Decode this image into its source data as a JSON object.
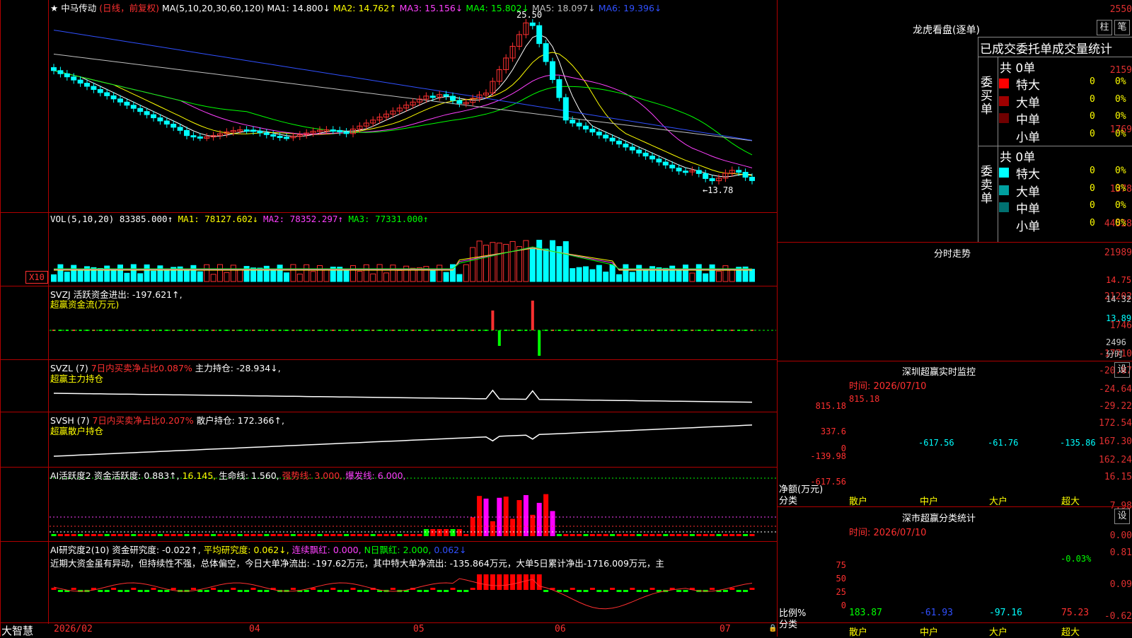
{
  "main": {
    "stock_name": "中马传动",
    "period": "(日线，前复权)",
    "ma_label": "MA(5,10,20,30,60,120)",
    "ma_values": [
      {
        "text": "MA1: 14.800↓",
        "color": "#ffffff"
      },
      {
        "text": "MA2: 14.762↑",
        "color": "#ffff00"
      },
      {
        "text": "MA3: 15.156↓",
        "color": "#ff40ff"
      },
      {
        "text": "MA4: 15.802↓",
        "color": "#00ff00"
      },
      {
        "text": "MA5: 18.097↓",
        "color": "#c0c0c0"
      },
      {
        "text": "MA6: 19.396↓",
        "color": "#3050ff"
      }
    ],
    "y_ticks": [
      "2550",
      "2159",
      "1769",
      "1378"
    ],
    "high_label": "25.50",
    "low_label": "←13.78",
    "colors": {
      "up": "#ff3030",
      "down": "#00ffff"
    }
  },
  "vol": {
    "label": "VOL(5,10,20)",
    "value": "83385.000↑",
    "mas": [
      {
        "text": "MA1: 78127.602↓",
        "color": "#ffff00"
      },
      {
        "text": "MA2: 78352.297↑",
        "color": "#ff40ff"
      },
      {
        "text": "MA3: 77331.000↑",
        "color": "#00ff00"
      }
    ],
    "y_ticks": [
      "44528",
      "21989"
    ],
    "unit": "X10"
  },
  "svzj": {
    "label": "SVZJ  活跃资金进出: -197.621↑,",
    "sub": "超赢资金流(万元)",
    "y_ticks": [
      "21202",
      "1746",
      "-17710"
    ]
  },
  "svzl": {
    "label": "SVZL (7)",
    "ratio": "7日内买卖净占比0.087%",
    "hold": "主力持仓: -28.934↓,",
    "sub": "超赢主力持仓",
    "y_ticks": [
      "-20.07",
      "-24.64",
      "-29.22"
    ]
  },
  "svsh": {
    "label": "SVSH (7)",
    "ratio": "7日内买卖净占比0.207%",
    "hold": "散户持仓: 172.366↑,",
    "sub": "超赢散户持仓",
    "y_ticks": [
      "172.54",
      "167.30",
      "162.24"
    ]
  },
  "ai1": {
    "label": "AI活跃度2",
    "parts": [
      {
        "text": "资金活跃度: 0.883↑,",
        "color": "#ffffff"
      },
      {
        "text": "16.145,",
        "color": "#ffff00"
      },
      {
        "text": "生命线: 1.560,",
        "color": "#ffffff"
      },
      {
        "text": "强势线: 3.000,",
        "color": "#ff3030"
      },
      {
        "text": "爆发线: 6.000,",
        "color": "#ff40ff"
      }
    ],
    "y_ticks": [
      "16.15",
      "7.98",
      "0.00"
    ]
  },
  "ai2": {
    "label": "AI研究度2(10)",
    "parts": [
      {
        "text": "资金研究度: -0.022↑,",
        "color": "#ffffff"
      },
      {
        "text": "平均研究度: 0.062↓,",
        "color": "#ffff00"
      },
      {
        "text": "连续飘红: 0.000,",
        "color": "#ff40ff"
      },
      {
        "text": "N日飘红: 2.000,",
        "color": "#00ff00"
      },
      {
        "text": "0.062↓",
        "color": "#3050ff"
      }
    ],
    "comment": "近期大资金虽有异动，但持续性不强，总体偏空，今日大单净流出: -197.62万元，其中特大单净流出: -135.864万元，大单5日累计净出-1716.009万元，主",
    "y_ticks": [
      "0.81",
      "0.09",
      "-0.62"
    ]
  },
  "x_axis": {
    "brand": "大智慧",
    "labels": [
      "2026/02",
      "04",
      "05",
      "06",
      "07"
    ]
  },
  "right": {
    "longhu": {
      "title": "龙虎看盘(逐单)",
      "btns": [
        "柱",
        "笔"
      ],
      "table_title": "已成交委托单成交量统计",
      "buy": {
        "side": "委买单",
        "total": "共 0单",
        "rows": [
          {
            "label": "特大",
            "v": "0",
            "p": "0%",
            "color": "#ff0000"
          },
          {
            "label": "大单",
            "v": "0",
            "p": "0%",
            "color": "#a00000"
          },
          {
            "label": "中单",
            "v": "0",
            "p": "0%",
            "color": "#700000"
          },
          {
            "label": "小单",
            "v": "0",
            "p": "0%",
            "color": ""
          }
        ]
      },
      "sell": {
        "side": "委卖单",
        "total": "共 0单",
        "rows": [
          {
            "label": "特大",
            "v": "0",
            "p": "0%",
            "color": "#00ffff"
          },
          {
            "label": "大单",
            "v": "0",
            "p": "0%",
            "color": "#00a0a0"
          },
          {
            "label": "中单",
            "v": "0",
            "p": "0%",
            "color": "#007070"
          },
          {
            "label": "小单",
            "v": "0",
            "p": "0%",
            "color": ""
          }
        ]
      }
    },
    "fenshi": {
      "title": "分时走势",
      "prices": [
        "14.75",
        "14.32",
        "13.89"
      ],
      "vol": "2496",
      "unit": "分时"
    },
    "monitor": {
      "title": "深圳超赢实时监控",
      "btn": "设",
      "time": "时间: 2026/07/10",
      "y_ticks": [
        "815.18",
        "337.6",
        "0",
        "-139.98",
        "-617.56"
      ],
      "y_label": "净额(万元)",
      "x_label": "分类",
      "cats": [
        "散户",
        "中户",
        "大户",
        "超大"
      ],
      "values": [
        815.18,
        -617.56,
        -61.76,
        -135.86
      ],
      "value_labels": [
        "815.18",
        "-617.56",
        "-61.76",
        "-135.86"
      ]
    },
    "classify": {
      "title": "深市超赢分类统计",
      "btn": "设",
      "time": "时间: 2026/07/10",
      "y_ticks": [
        "75",
        "50",
        "25",
        "0"
      ],
      "y_label": "比例%",
      "x_label": "分类",
      "cats": [
        "散户",
        "中户",
        "大户",
        "超大"
      ],
      "values": [
        "183.87",
        "-61.93",
        "-97.16",
        "75.23"
      ],
      "top_label": "-0.03%"
    }
  }
}
